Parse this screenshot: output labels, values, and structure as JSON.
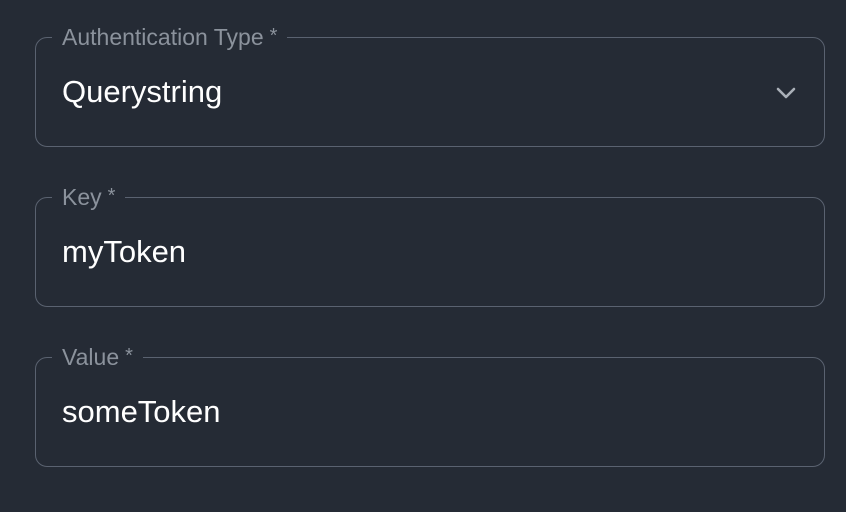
{
  "fields": {
    "auth_type": {
      "label": "Authentication Type",
      "required_mark": "*",
      "value": "Querystring",
      "icon": "chevron-down-icon"
    },
    "key": {
      "label": "Key",
      "required_mark": "*",
      "value": "myToken"
    },
    "value": {
      "label": "Value",
      "required_mark": "*",
      "value": "someToken"
    }
  },
  "colors": {
    "background": "#252b35",
    "border": "#5a6270",
    "label": "#8b929c",
    "text": "#ffffff"
  }
}
